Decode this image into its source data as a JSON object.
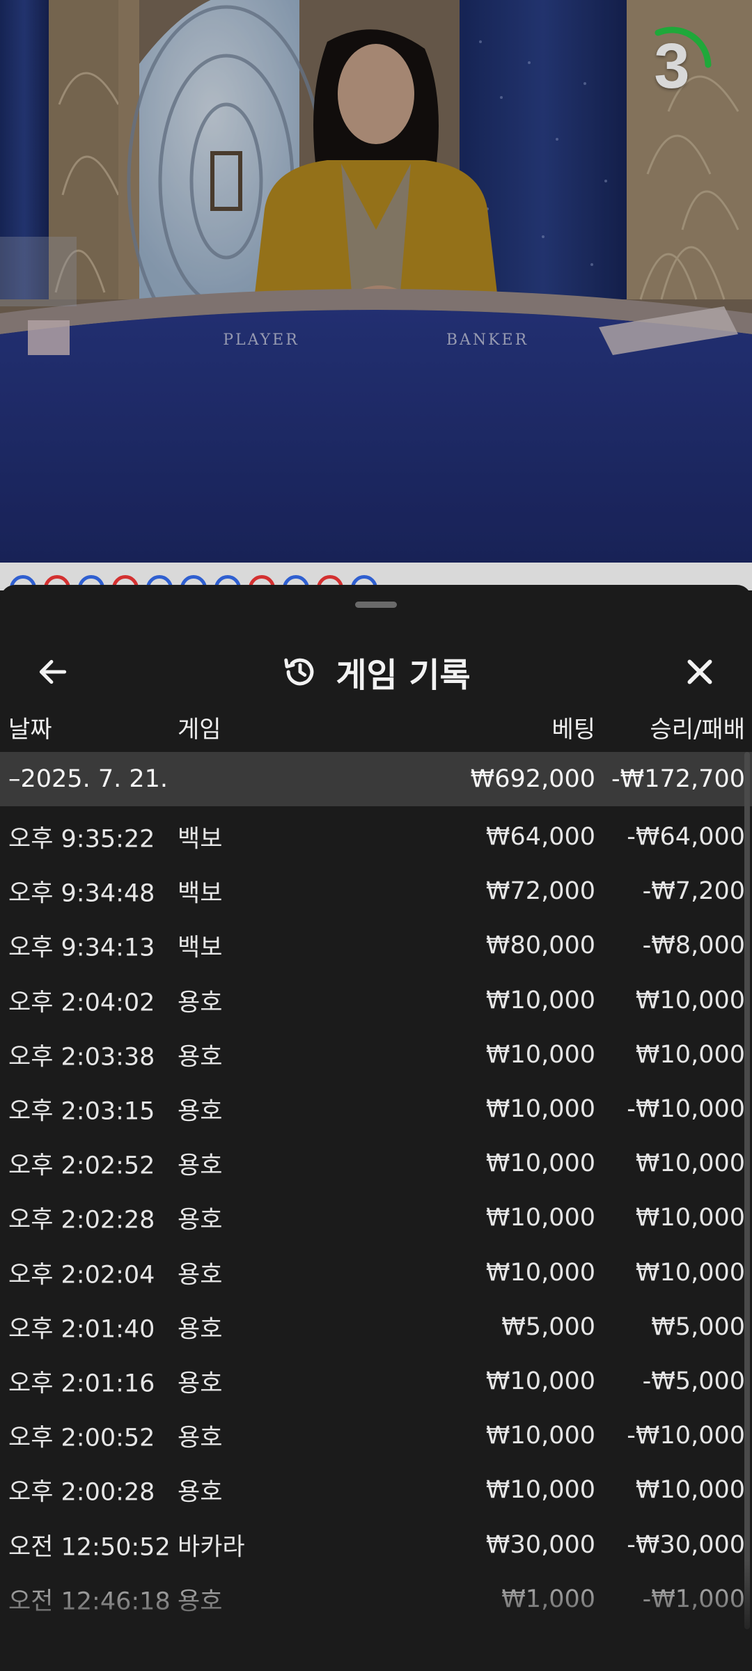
{
  "live": {
    "countdown": "3",
    "table_labels": {
      "player": "PLAYER",
      "banker": "BANKER"
    },
    "road_beads": [
      "blue",
      "red",
      "blue",
      "red",
      "blue",
      "blue",
      "blue",
      "red",
      "blue",
      "red",
      "blue"
    ],
    "colors": {
      "player": "#2f5fd0",
      "banker": "#d33030",
      "timer_arc": "#1fa83a"
    }
  },
  "history": {
    "title": "게임 기록",
    "icons": {
      "back": "arrow-left-icon",
      "title": "history-icon",
      "close": "close-icon"
    },
    "columns": {
      "date": "날짜",
      "game": "게임",
      "bet": "베팅",
      "winloss": "승리/패배"
    },
    "group": {
      "date": "–2025. 7. 21.",
      "bet": "₩692,000",
      "winloss": "-₩172,700"
    },
    "rows": [
      {
        "time": "오후 9:35:22",
        "game": "백보",
        "bet": "₩64,000",
        "winloss": "-₩64,000"
      },
      {
        "time": "오후 9:34:48",
        "game": "백보",
        "bet": "₩72,000",
        "winloss": "-₩7,200"
      },
      {
        "time": "오후 9:34:13",
        "game": "백보",
        "bet": "₩80,000",
        "winloss": "-₩8,000"
      },
      {
        "time": "오후 2:04:02",
        "game": "용호",
        "bet": "₩10,000",
        "winloss": "₩10,000"
      },
      {
        "time": "오후 2:03:38",
        "game": "용호",
        "bet": "₩10,000",
        "winloss": "₩10,000"
      },
      {
        "time": "오후 2:03:15",
        "game": "용호",
        "bet": "₩10,000",
        "winloss": "-₩10,000"
      },
      {
        "time": "오후 2:02:52",
        "game": "용호",
        "bet": "₩10,000",
        "winloss": "₩10,000"
      },
      {
        "time": "오후 2:02:28",
        "game": "용호",
        "bet": "₩10,000",
        "winloss": "₩10,000"
      },
      {
        "time": "오후 2:02:04",
        "game": "용호",
        "bet": "₩10,000",
        "winloss": "₩10,000"
      },
      {
        "time": "오후 2:01:40",
        "game": "용호",
        "bet": "₩5,000",
        "winloss": "₩5,000"
      },
      {
        "time": "오후 2:01:16",
        "game": "용호",
        "bet": "₩10,000",
        "winloss": "-₩5,000"
      },
      {
        "time": "오후 2:00:52",
        "game": "용호",
        "bet": "₩10,000",
        "winloss": "-₩10,000"
      },
      {
        "time": "오후 2:00:28",
        "game": "용호",
        "bet": "₩10,000",
        "winloss": "₩10,000"
      },
      {
        "time": "오전 12:50:52",
        "game": "바카라",
        "bet": "₩30,000",
        "winloss": "-₩30,000"
      },
      {
        "time": "오전 12:46:18",
        "game": "용호",
        "bet": "₩1,000",
        "winloss": "-₩1,000"
      }
    ]
  }
}
